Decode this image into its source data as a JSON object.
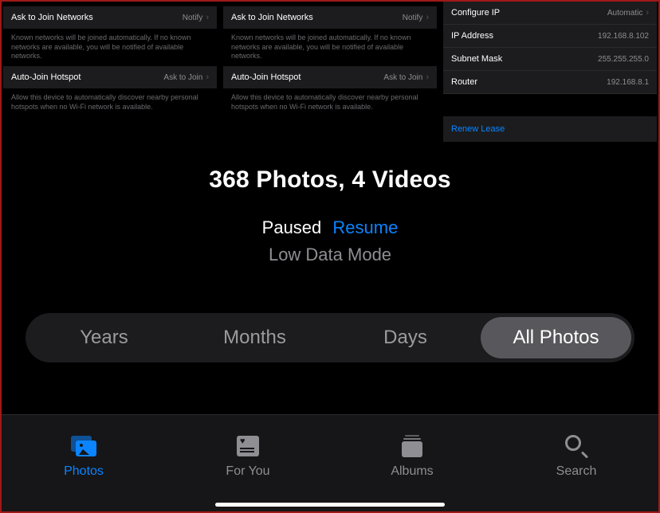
{
  "thumbnails": {
    "panelA": {
      "row1_label": "Ask to Join Networks",
      "row1_value": "Notify",
      "foot1": "Known networks will be joined automatically. If no known networks are available, you will be notified of available networks.",
      "row2_label": "Auto-Join Hotspot",
      "row2_value": "Ask to Join",
      "foot2": "Allow this device to automatically discover nearby personal hotspots when no Wi-Fi network is available."
    },
    "panelB": {
      "row1_label": "Ask to Join Networks",
      "row1_value": "Notify",
      "foot1": "Known networks will be joined automatically. If no known networks are available, you will be notified of available networks.",
      "row2_label": "Auto-Join Hotspot",
      "row2_value": "Ask to Join",
      "foot2": "Allow this device to automatically discover nearby personal hotspots when no Wi-Fi network is available."
    },
    "panelC": {
      "rows": [
        {
          "k": "Configure IP",
          "v": "Automatic"
        },
        {
          "k": "IP Address",
          "v": "192.168.8.102"
        },
        {
          "k": "Subnet Mask",
          "v": "255.255.255.0"
        },
        {
          "k": "Router",
          "v": "192.168.8.1"
        }
      ],
      "renew": "Renew Lease"
    }
  },
  "summary": {
    "count_text": "368 Photos, 4 Videos",
    "paused": "Paused",
    "resume": "Resume",
    "mode": "Low Data Mode"
  },
  "segments": {
    "years": "Years",
    "months": "Months",
    "days": "Days",
    "all": "All Photos"
  },
  "tabs": {
    "photos": "Photos",
    "foryou": "For You",
    "albums": "Albums",
    "search": "Search"
  }
}
